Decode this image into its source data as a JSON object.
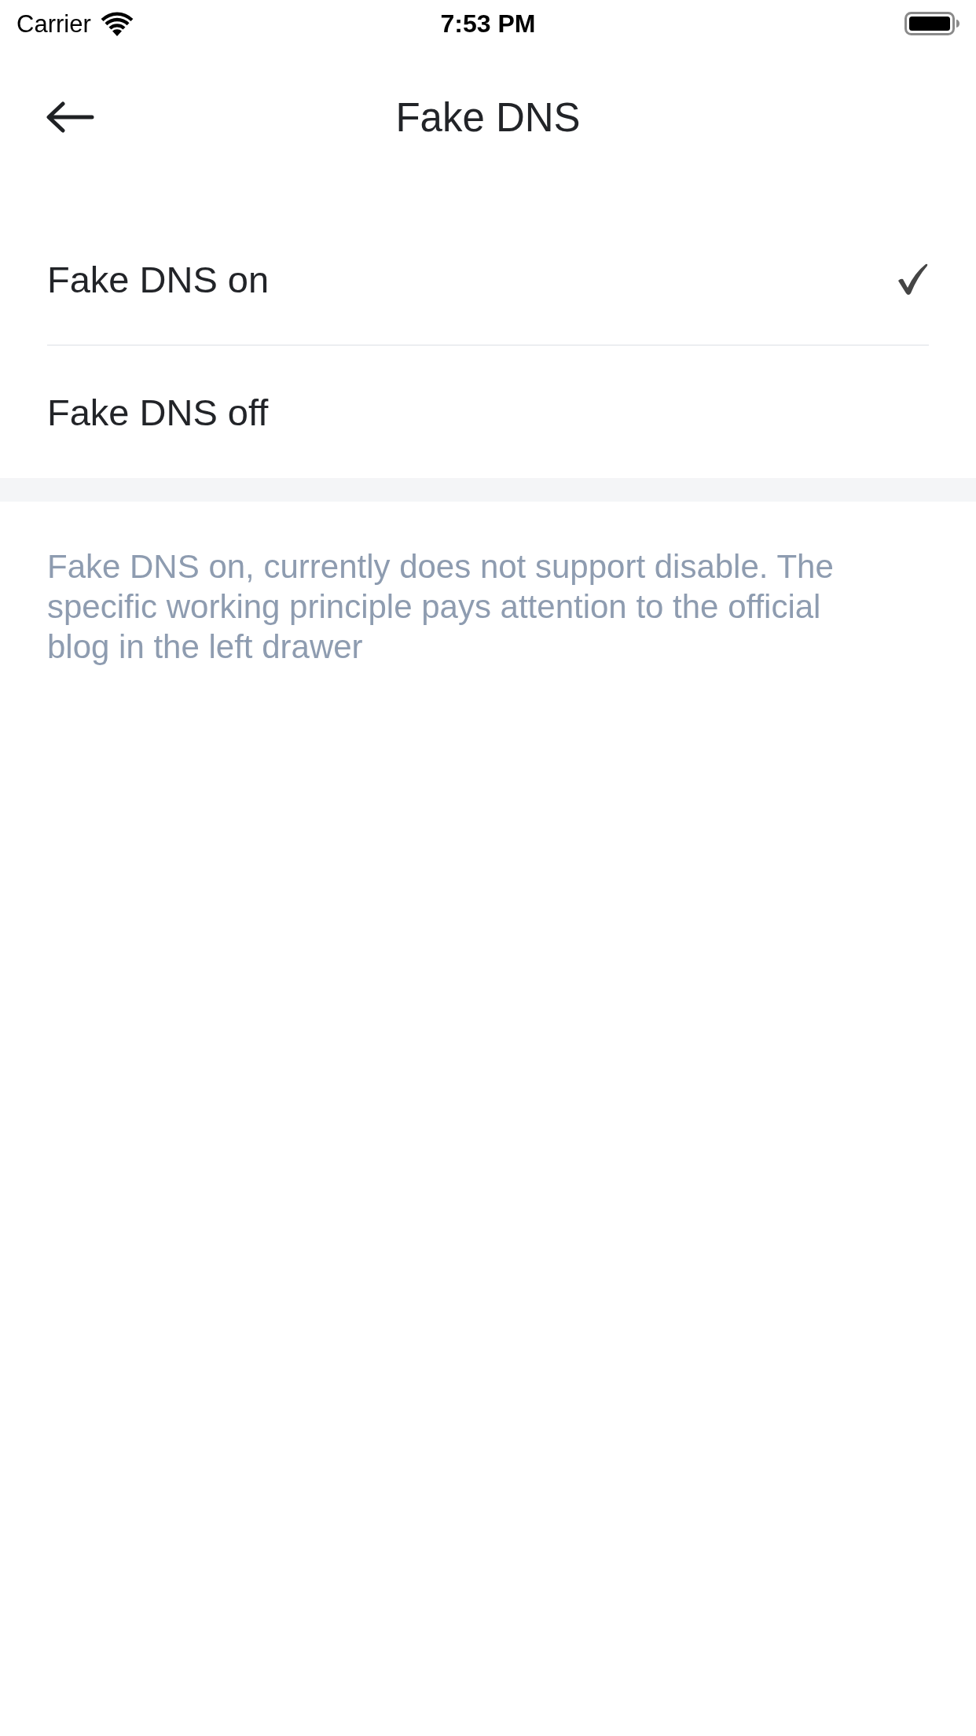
{
  "status_bar": {
    "carrier": "Carrier",
    "time": "7:53 PM"
  },
  "header": {
    "title": "Fake DNS"
  },
  "options": [
    {
      "label": "Fake DNS on",
      "selected": true
    },
    {
      "label": "Fake DNS off",
      "selected": false
    }
  ],
  "note": "Fake DNS on, currently does not support disable. The specific working principle pays attention to the official blog in the left drawer"
}
